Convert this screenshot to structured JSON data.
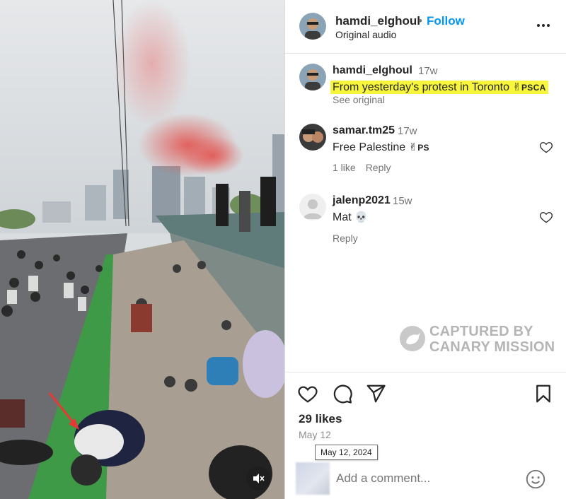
{
  "post_header": {
    "username": "hamdi_elghoul",
    "separator": "•",
    "follow_label": "Follow",
    "audio_label": "Original audio"
  },
  "caption": {
    "username": "hamdi_elghoul",
    "time": "17w",
    "text": "From yesterday's protest in Toronto ",
    "emoji": "✌",
    "flag_code": "PSCA",
    "see_original": "See original",
    "highlight_color": "#f7f53c"
  },
  "comments": [
    {
      "username": "samar.tm25",
      "time": "17w",
      "text": "Free Palestine ",
      "emoji": "✌",
      "flag_code": "PS",
      "likes_label": "1 like",
      "reply_label": "Reply"
    },
    {
      "username": "jalenp2021",
      "time": "15w",
      "text": "Mat ",
      "emoji": "💀",
      "reply_label": "Reply"
    }
  ],
  "watermark": {
    "line1": "CAPTURED BY",
    "line2": "CANARY MISSION"
  },
  "actions": {
    "like_icon": "heart-outline-icon",
    "comment_icon": "comment-bubble-icon",
    "share_icon": "paper-plane-icon",
    "save_icon": "bookmark-icon"
  },
  "likes_label": "29 likes",
  "date_label": "May 12",
  "date_tooltip": "May 12, 2024",
  "comment_input": {
    "placeholder": "Add a comment..."
  },
  "colors": {
    "accent": "#0095f6",
    "text": "#262626",
    "muted": "#737373"
  }
}
